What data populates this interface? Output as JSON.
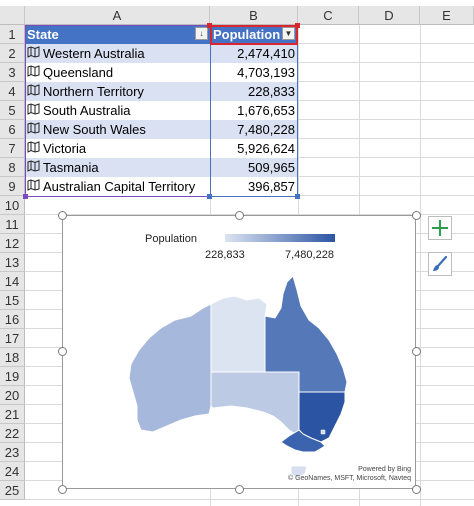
{
  "columns": [
    "A",
    "B",
    "C",
    "D",
    "E"
  ],
  "rows": [
    "1",
    "2",
    "3",
    "4",
    "5",
    "6",
    "7",
    "8",
    "9",
    "10",
    "11",
    "12",
    "13",
    "14",
    "15",
    "16",
    "17",
    "18",
    "19",
    "20",
    "21",
    "22",
    "23",
    "24",
    "25"
  ],
  "table": {
    "headers": {
      "state": "State",
      "population": "Population"
    },
    "filter_glyphs": {
      "state": "↓",
      "population": "▼"
    },
    "rows": [
      {
        "state": "Western Australia",
        "population": "2,474,410"
      },
      {
        "state": "Queensland",
        "population": "4,703,193"
      },
      {
        "state": "Northern Territory",
        "population": "228,833"
      },
      {
        "state": "South Australia",
        "population": "1,676,653"
      },
      {
        "state": "New South Wales",
        "population": "7,480,228"
      },
      {
        "state": "Victoria",
        "population": "5,926,624"
      },
      {
        "state": "Tasmania",
        "population": "509,965"
      },
      {
        "state": "Australian Capital Territory",
        "population": "396,857"
      }
    ]
  },
  "map_chart": {
    "legend_title": "Population",
    "legend_min": "228,833",
    "legend_max": "7,480,228",
    "attribution_line1": "Powered by Bing",
    "attribution_line2": "© GeoNames, MSFT, Microsoft, Navteq",
    "color_low": "#dce4f2",
    "color_high": "#2b55a3"
  },
  "side_buttons": {
    "chart_elements": "+",
    "chart_styles_icon": "paintbrush-icon"
  },
  "colors": {
    "header_blue": "#4472c4",
    "band": "#d9e1f2",
    "selection_purple": "#7a4bbf",
    "selection_red": "#d9262c"
  }
}
